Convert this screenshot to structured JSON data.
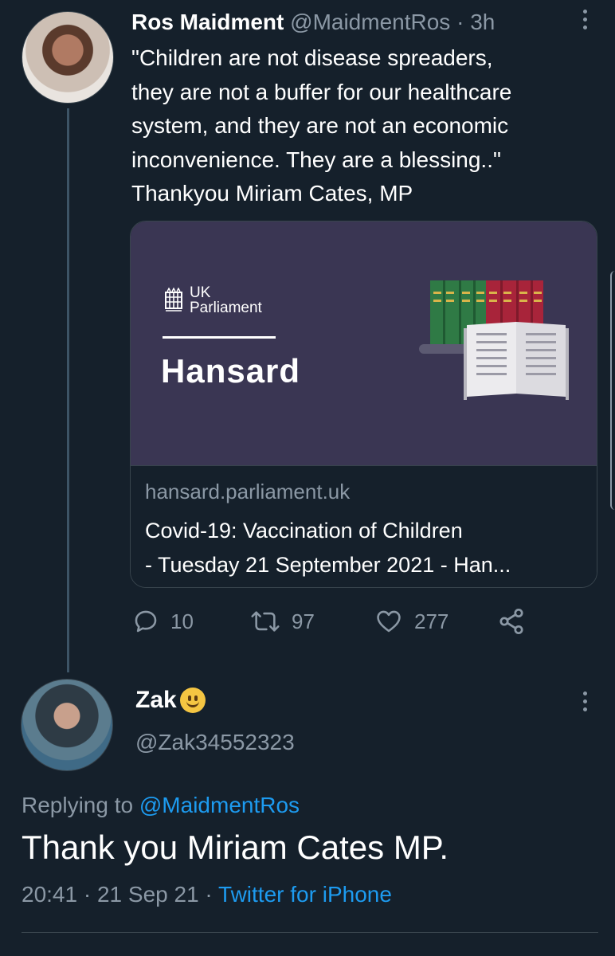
{
  "colors": {
    "background": "#15202b",
    "secondary_text": "#8b98a5",
    "link": "#1d9bf0",
    "card_background": "#3a3653",
    "border": "#38444d"
  },
  "tweet": {
    "author_name": "Ros Maidment",
    "author_handle": "@MaidmentRos",
    "separator": "·",
    "time_ago": "3h",
    "text_lines": [
      "\"Children are not disease spreaders,",
      "they are not a buffer for our healthcare",
      "system, and they are not an economic",
      "inconvenience. They are a blessing..\"",
      "Thankyou Miriam Cates, MP"
    ],
    "card": {
      "brand_line1": "UK",
      "brand_line2": "Parliament",
      "image_title": "Hansard",
      "domain": "hansard.parliament.uk",
      "title_lines": [
        "Covid-19: Vaccination of Children",
        "- Tuesday 21 September 2021 - Han..."
      ]
    },
    "actions": {
      "replies": "10",
      "retweets": "97",
      "likes": "277"
    },
    "icons": [
      "reply-icon",
      "retweet-icon",
      "like-icon",
      "share-icon",
      "more-options-icon"
    ]
  },
  "reply": {
    "author_name": "Zak",
    "author_emoji": "slightly-smiling-face-emoji",
    "author_handle": "@Zak34552323",
    "replying_prefix": "Replying to",
    "replying_handle": "@MaidmentRos",
    "text": "Thank you Miriam Cates MP.",
    "time": "20:41",
    "separator": "·",
    "date": "21 Sep 21",
    "source": "Twitter for iPhone"
  }
}
